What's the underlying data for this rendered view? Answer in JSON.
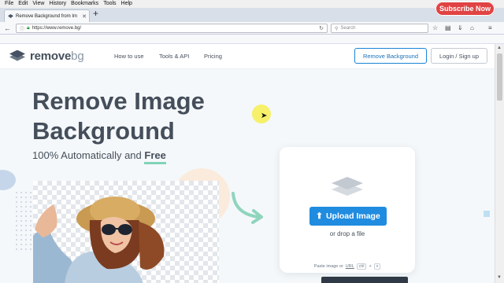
{
  "browser": {
    "menu": [
      "File",
      "Edit",
      "View",
      "History",
      "Bookmarks",
      "Tools",
      "Help"
    ],
    "tab_title": "Remove Background from Im",
    "new_tab": "+",
    "url": "https://www.remove.bg/",
    "search_placeholder": "Search"
  },
  "overlay": {
    "subscribe_label": "Subscribe Now"
  },
  "site": {
    "logo_main": "remove",
    "logo_suffix": "bg",
    "nav": [
      "How to use",
      "Tools & API",
      "Pricing"
    ],
    "btn_remove": "Remove Background",
    "btn_login": "Login / Sign up"
  },
  "hero": {
    "title_line1": "Remove Image",
    "title_line2": "Background",
    "subtitle_prefix": "100% Automatically and ",
    "subtitle_free": "Free"
  },
  "upload": {
    "button_label": "Upload Image",
    "drop_text": "or drop a file",
    "paste_prefix": "Paste image or",
    "paste_url": "URL",
    "key_ctrl": "ctrl",
    "key_plus": "+",
    "key_v": "v"
  },
  "colors": {
    "accent": "#1f8ce0",
    "brand_text": "#454f5b",
    "underline": "#80d4b7",
    "subscribe": "#e04343"
  }
}
